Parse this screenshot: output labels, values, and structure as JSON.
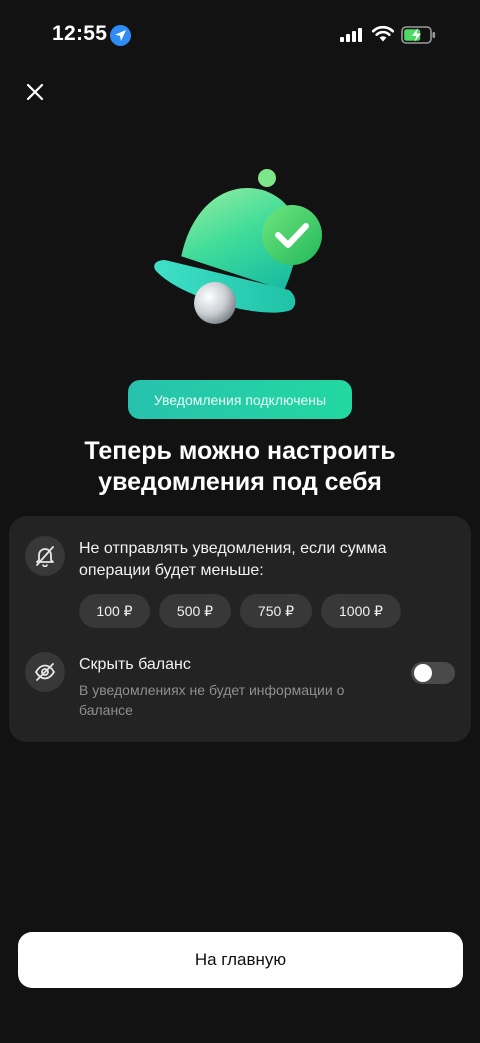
{
  "status_bar": {
    "time": "12:55",
    "icons": [
      "location-arrow-icon",
      "signal-icon",
      "wifi-icon",
      "battery-charging-icon"
    ]
  },
  "header": {
    "close_icon": "close-icon"
  },
  "hero": {
    "illustration": "bell-check-icon",
    "chip_label": "Уведомления подключены",
    "title": "Теперь можно настроить уведомления под себя"
  },
  "settings": {
    "threshold": {
      "icon": "bell-off-icon",
      "label": "Не отправлять уведомления, если сумма операции будет меньше:",
      "amounts": [
        "100 ₽",
        "500 ₽",
        "750 ₽",
        "1000 ₽"
      ]
    },
    "hide_balance": {
      "icon": "eye-off-icon",
      "title": "Скрыть баланс",
      "description": "В уведомлениях не будет информации о балансе",
      "enabled": false
    }
  },
  "footer": {
    "home_button_label": "На главную"
  },
  "colors": {
    "background": "#121212",
    "card": "#232323",
    "accent": "#22d8a0",
    "ios_blue": "#2f8cf4",
    "battery_green": "#4cd964"
  }
}
